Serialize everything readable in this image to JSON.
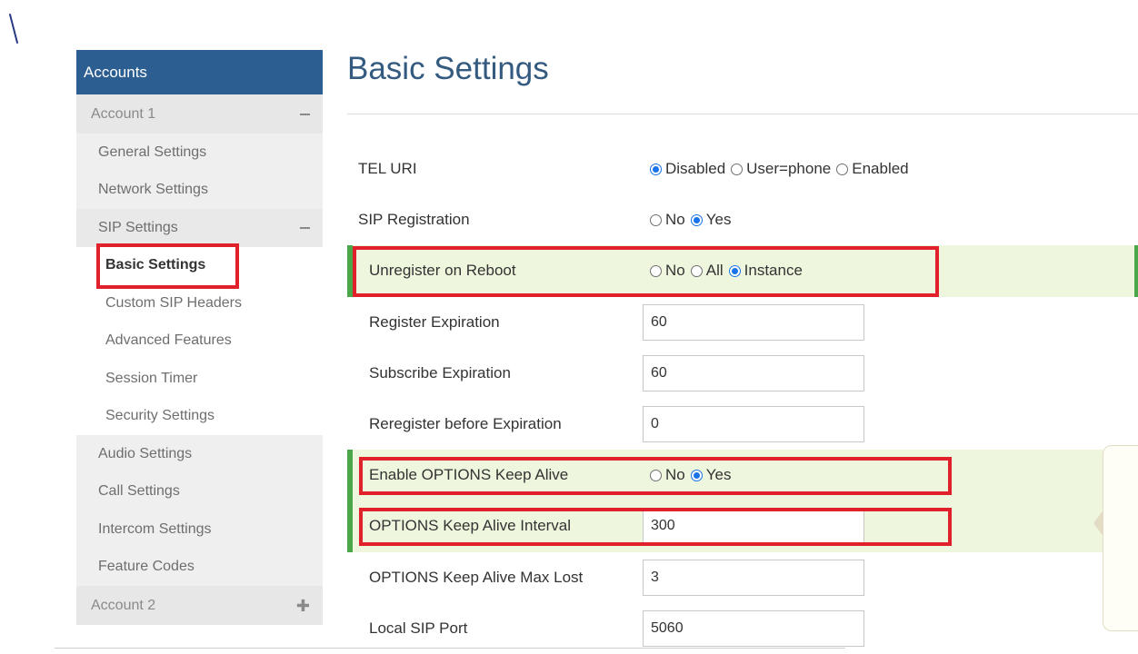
{
  "sidebar": {
    "header": "Accounts",
    "account1": {
      "label": "Account 1",
      "expanded": true
    },
    "items_top": [
      "General Settings",
      "Network Settings"
    ],
    "sip_settings": {
      "label": "SIP Settings",
      "expanded": true
    },
    "sip_sub": [
      "Basic Settings",
      "Custom SIP Headers",
      "Advanced Features",
      "Session Timer",
      "Security Settings"
    ],
    "active_item": "Basic Settings",
    "items_bottom": [
      "Audio Settings",
      "Call Settings",
      "Intercom Settings",
      "Feature Codes"
    ],
    "account2": {
      "label": "Account 2",
      "expanded": false
    }
  },
  "page": {
    "title": "Basic Settings"
  },
  "form": {
    "tel_uri": {
      "label": "TEL URI",
      "options": [
        "Disabled",
        "User=phone",
        "Enabled"
      ],
      "selected": "Disabled"
    },
    "sip_registration": {
      "label": "SIP Registration",
      "options": [
        "No",
        "Yes"
      ],
      "selected": "Yes"
    },
    "unregister_on_reboot": {
      "label": "Unregister on Reboot",
      "options": [
        "No",
        "All",
        "Instance"
      ],
      "selected": "Instance"
    },
    "register_expiration": {
      "label": "Register Expiration",
      "value": "60"
    },
    "subscribe_expiration": {
      "label": "Subscribe Expiration",
      "value": "60"
    },
    "reregister_before_expiration": {
      "label": "Reregister before Expiration",
      "value": "0"
    },
    "enable_options_keep_alive": {
      "label": "Enable OPTIONS Keep Alive",
      "options": [
        "No",
        "Yes"
      ],
      "selected": "Yes"
    },
    "options_keep_alive_interval": {
      "label": "OPTIONS Keep Alive Interval",
      "value": "300"
    },
    "options_keep_alive_max_lost": {
      "label": "OPTIONS Keep Alive Max Lost",
      "value": "3"
    },
    "local_sip_port": {
      "label": "Local SIP Port",
      "value": "5060"
    }
  },
  "colors": {
    "sidebar_header": "#2d5e92",
    "highlight_row": "#eef7de",
    "highlight_bar": "#4aa84a",
    "annotation_box": "#e0202a",
    "radio_checked": "#1a73e8"
  }
}
